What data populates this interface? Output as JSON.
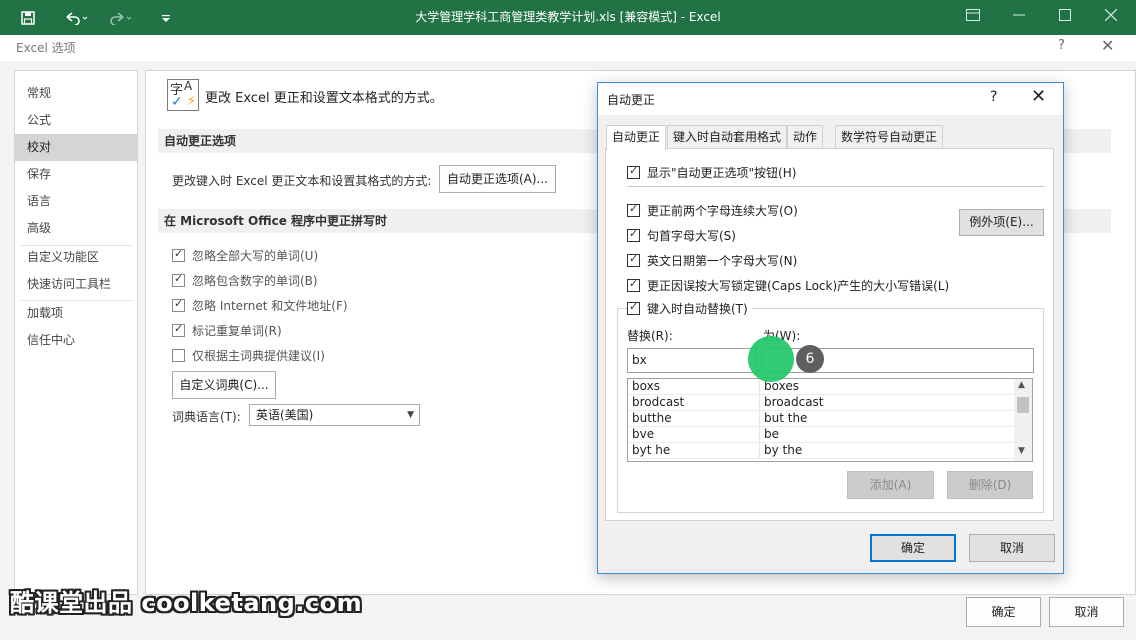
{
  "titlebar": {
    "save_icon": "save-icon",
    "undo_icon": "undo-icon",
    "redo_icon": "redo-icon",
    "title": "大学管理学科工商管理类教学计划.xls  [兼容模式] - Excel",
    "btn_ribbon": "ribbon-display-icon",
    "btn_min": "minimize-icon",
    "btn_max": "maximize-icon",
    "btn_close": "close-icon"
  },
  "options_dialog": {
    "title": "Excel 选项",
    "help": "?",
    "close": "✕",
    "nav": [
      "常规",
      "公式",
      "校对",
      "保存",
      "语言",
      "高级",
      "自定义功能区",
      "快速访问工具栏",
      "加载项",
      "信任中心"
    ],
    "selected_nav": "校对",
    "heading": "更改 Excel 更正和设置文本格式的方式。",
    "section_autocorrect": "自动更正选项",
    "autocorrect_text": "更改键入时 Excel 更正文本和设置其格式的方式:",
    "autocorrect_button": "自动更正选项(A)...",
    "section_spelling": "在 Microsoft Office 程序中更正拼写时",
    "checkboxes": [
      {
        "label": "忽略全部大写的单词(U)",
        "checked": true
      },
      {
        "label": "忽略包含数字的单词(B)",
        "checked": true
      },
      {
        "label": "忽略 Internet 和文件地址(F)",
        "checked": true
      },
      {
        "label": "标记重复单词(R)",
        "checked": true
      },
      {
        "label": "仅根据主词典提供建议(I)",
        "checked": false
      }
    ],
    "custom_dict_button": "自定义词典(C)...",
    "dict_lang_label": "词典语言(T):",
    "dict_lang_value": "英语(美国)",
    "ok": "确定",
    "cancel": "取消"
  },
  "autocorrect_dialog": {
    "title": "自动更正",
    "help": "?",
    "close": "✕",
    "tabs": [
      "自动更正",
      "键入时自动套用格式",
      "动作",
      "数学符号自动更正"
    ],
    "selected_tab": "自动更正",
    "show_button_cb": {
      "label": "显示\"自动更正选项\"按钮(H)",
      "checked": true
    },
    "options": [
      {
        "label": "更正前两个字母连续大写(O)",
        "checked": true
      },
      {
        "label": "句首字母大写(S)",
        "checked": true
      },
      {
        "label": "英文日期第一个字母大写(N)",
        "checked": true
      },
      {
        "label": "更正因误按大写锁定键(Caps Lock)产生的大小写错误(L)",
        "checked": true
      },
      {
        "label": "键入时自动替换(T)",
        "checked": true
      }
    ],
    "exceptions_button": "例外项(E)...",
    "replace_label": "替换(R):",
    "with_label": "为(W):",
    "replace_value": "bx",
    "with_value": "",
    "list": [
      {
        "replace": "boxs",
        "with": "boxes"
      },
      {
        "replace": "brodcast",
        "with": "broadcast"
      },
      {
        "replace": "butthe",
        "with": "but the"
      },
      {
        "replace": "bve",
        "with": "be"
      },
      {
        "replace": "byt he",
        "with": "by the"
      }
    ],
    "add_button": "添加(A)",
    "delete_button": "删除(D)",
    "ok": "确定",
    "cancel": "取消"
  },
  "overlay": {
    "step_number": "6",
    "watermark": "酷课堂出品 coolketang.com"
  },
  "colors": {
    "titlebar_green": "#217346",
    "cursor_highlight": "#1fc768",
    "focus_blue": "#0078d7"
  }
}
